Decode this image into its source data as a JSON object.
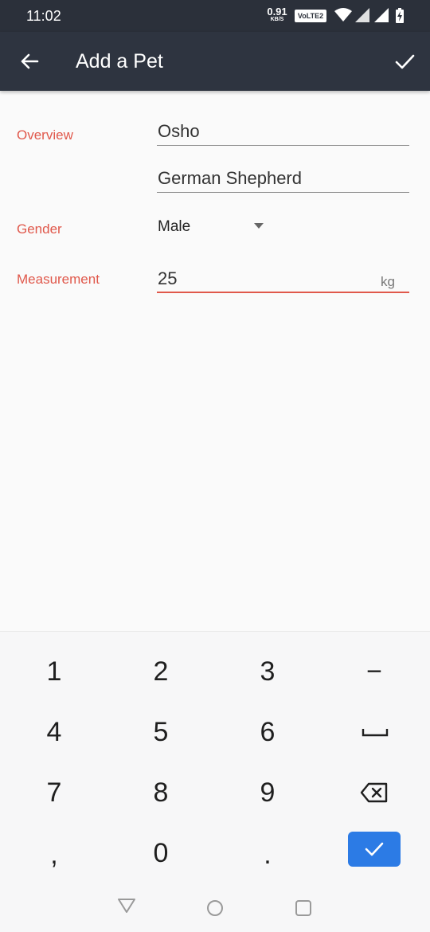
{
  "status_bar": {
    "time": "11:02",
    "speed_value": "0.91",
    "speed_unit": "KB/S",
    "network_label": "VoLTE2",
    "icons": [
      "wifi-icon",
      "signal-icon",
      "signal-icon",
      "battery-charging-icon"
    ]
  },
  "app_bar": {
    "title": "Add a Pet",
    "back_icon": "arrow-left-icon",
    "done_icon": "check-icon"
  },
  "form": {
    "overview_label": "Overview",
    "name_value": "Osho",
    "breed_value": "German Shepherd",
    "gender_label": "Gender",
    "gender_value": "Male",
    "measurement_label": "Measurement",
    "measurement_value": "25",
    "measurement_unit": "kg"
  },
  "keyboard": {
    "row1": [
      "1",
      "2",
      "3",
      "−"
    ],
    "row2": [
      "4",
      "5",
      "6"
    ],
    "row3": [
      "7",
      "8",
      "9"
    ],
    "row4": [
      ",",
      "0",
      "."
    ],
    "space_icon": "space-icon",
    "backspace_icon": "backspace-icon",
    "done_icon": "check-icon"
  },
  "nav_bar": {
    "icons": [
      "back-triangle-icon",
      "home-circle-icon",
      "recents-square-icon"
    ]
  },
  "colors": {
    "accent": "#e0584b",
    "app_bar": "#2e3440",
    "status_bar": "#2b303a",
    "keyboard_action": "#2c7be5"
  }
}
